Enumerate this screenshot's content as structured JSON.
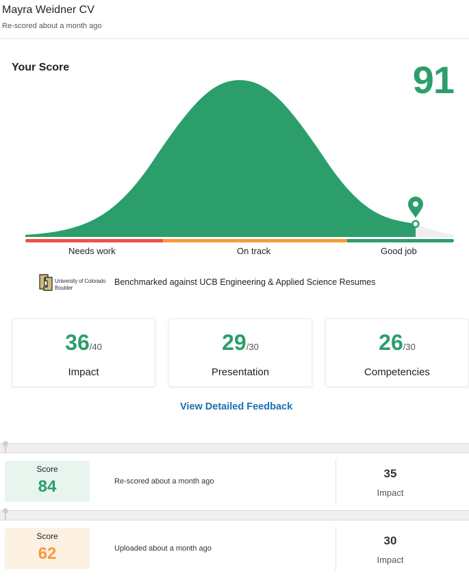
{
  "header": {
    "title": "Mayra Weidner CV",
    "subtitle": "Re-scored about a month ago"
  },
  "score_panel": {
    "heading": "Your Score",
    "score": "91",
    "score_fraction": 0.91,
    "bands": [
      "Needs work",
      "On track",
      "Good job"
    ],
    "colors": {
      "green": "#2b9e6c",
      "red": "#ee5147",
      "orange": "#f69a3b",
      "link": "#1a6fb0"
    }
  },
  "benchmark": {
    "logo_text_line1": "University of Colorado",
    "logo_text_line2": "Boulder",
    "text": "Benchmarked against UCB Engineering & Applied Science Resumes"
  },
  "categories": [
    {
      "score": "36",
      "max": "/40",
      "label": "Impact"
    },
    {
      "score": "29",
      "max": "/30",
      "label": "Presentation"
    },
    {
      "score": "26",
      "max": "/30",
      "label": "Competencies"
    }
  ],
  "feedback_link": "View Detailed Feedback",
  "history": [
    {
      "score_caption": "Score",
      "score": "84",
      "status": "Re-scored about a month ago",
      "metric_value": "35",
      "metric_label": "Impact"
    },
    {
      "score_caption": "Score",
      "score": "62",
      "status": "Uploaded about a month ago",
      "metric_value": "30",
      "metric_label": "Impact"
    }
  ]
}
